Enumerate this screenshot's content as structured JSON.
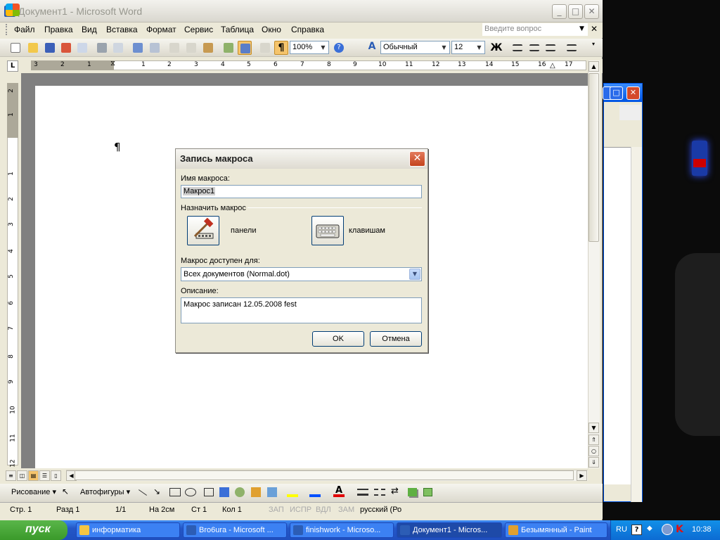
{
  "window": {
    "title": "Документ1 - Microsoft Word",
    "icon": "W",
    "minimize": "_",
    "maximize": "□",
    "close": "✕"
  },
  "menu": {
    "items": [
      "Файл",
      "Правка",
      "Вид",
      "Вставка",
      "Формат",
      "Сервис",
      "Таблица",
      "Окно",
      "Справка"
    ],
    "ask_placeholder": "Введите вопрос",
    "close": "✕"
  },
  "toolbar": {
    "zoom": "100%",
    "style": "Обычный",
    "font_size": "12",
    "bold": "Ж",
    "pilcrow_btn": "¶",
    "help_btn": "?"
  },
  "ruler": {
    "h_ticks": [
      "3",
      "2",
      "1",
      "1",
      "2",
      "3",
      "4",
      "5",
      "6",
      "7",
      "8",
      "9",
      "10",
      "11",
      "12",
      "13",
      "14",
      "15",
      "16",
      "17"
    ],
    "v_ticks": [
      "2",
      "1",
      "1",
      "2",
      "3",
      "4",
      "5",
      "6",
      "7",
      "8",
      "9",
      "10",
      "11",
      "12"
    ],
    "tab_mark": "L"
  },
  "document": {
    "pilcrow": "¶"
  },
  "dialog": {
    "title": "Запись макроса",
    "close": "✕",
    "name_label": "Имя макроса:",
    "name_value": "Макрос1",
    "assign_label": "Назначить макрос",
    "toolbar_label": "панели",
    "keyboard_label": "клавишам",
    "available_label": "Макрос доступен для:",
    "available_value": "Всех документов (Normal.dot)",
    "description_label": "Описание:",
    "description_value": "Макрос записан 12.05.2008 fest",
    "ok": "OK",
    "cancel": "Отмена"
  },
  "drawing": {
    "draw": "Рисование ▾",
    "autoshapes": "Автофигуры ▾"
  },
  "status": {
    "page": "Стр.  1",
    "section": "Разд  1",
    "pages": "1/1",
    "at": "На  2см",
    "line": "Ст  1",
    "col": "Кол  1",
    "rec": "ЗАП",
    "trk": "ИСПР",
    "ext": "ВДЛ",
    "ovr": "ЗАМ",
    "lang": "русский (Ро"
  },
  "taskbar": {
    "start": "пуск",
    "tasks": [
      {
        "label": "информатика",
        "icon_color": "#f4c542"
      },
      {
        "label": "Bro6ura - Microsoft ...",
        "icon_color": "#2c5db5"
      },
      {
        "label": "finishwork - Microso...",
        "icon_color": "#2c5db5"
      },
      {
        "label": "Документ1 - Micros...",
        "icon_color": "#2c5db5"
      },
      {
        "label": "Безымянный - Paint",
        "icon_color": "#e0a030"
      }
    ],
    "lang": "RU",
    "clock": "10:38",
    "help": "?"
  },
  "colors": {
    "xp_blue": "#0054e3",
    "taskbar": "#2457c7",
    "start_green": "#3a9a2a",
    "dialog_bg": "#ece9d8",
    "close_red": "#c4431c"
  }
}
